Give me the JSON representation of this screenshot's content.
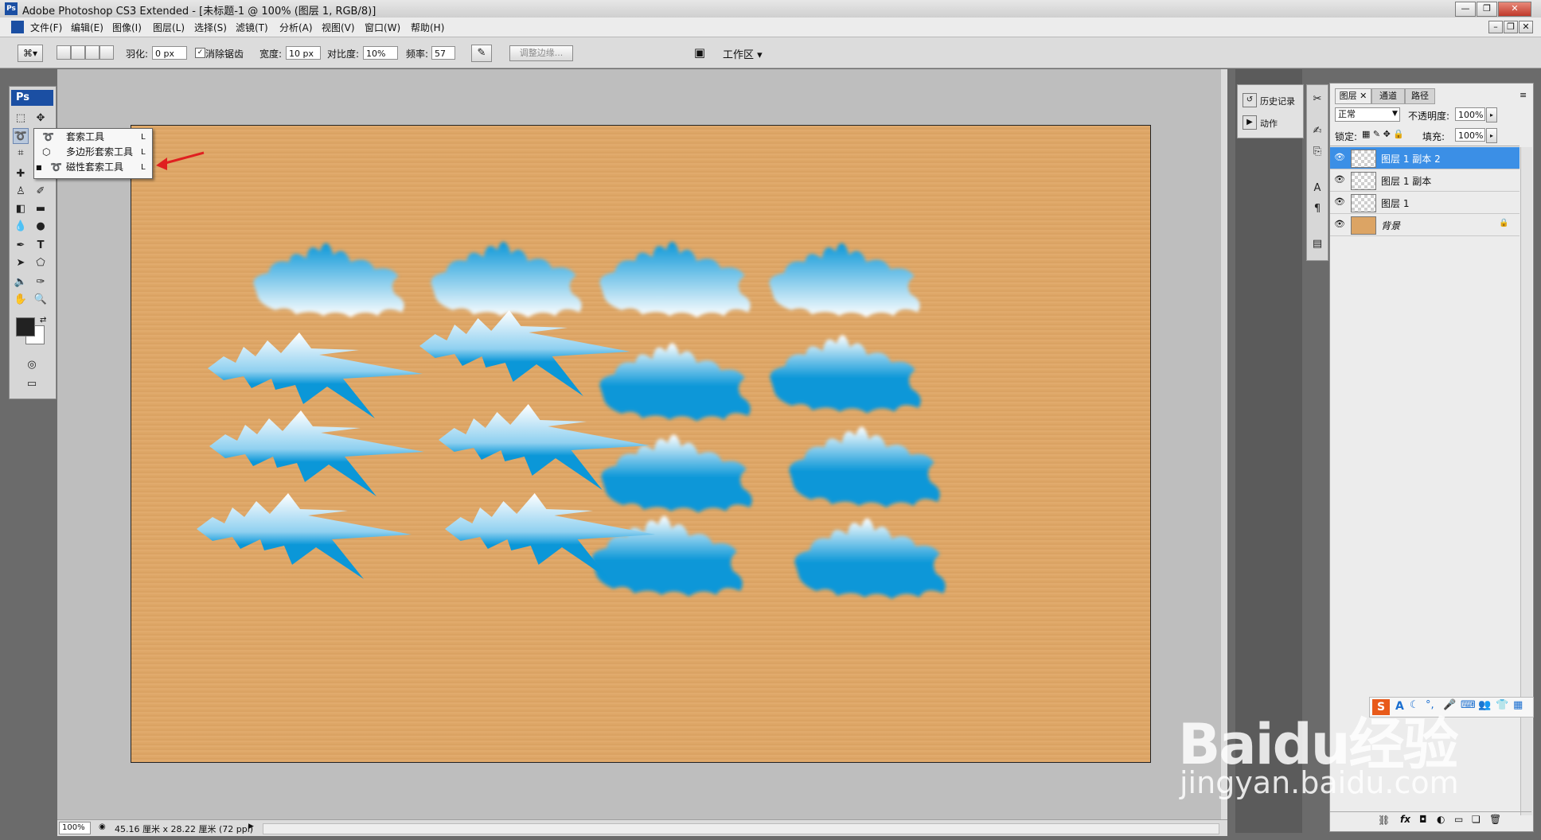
{
  "window": {
    "app_icon": "Ps",
    "title": "Adobe Photoshop CS3 Extended - [未标题-1 @ 100% (图层 1, RGB/8)]",
    "controls": [
      "minimize",
      "restore",
      "close"
    ]
  },
  "menu": {
    "items": [
      "文件(F)",
      "编辑(E)",
      "图像(I)",
      "图层(L)",
      "选择(S)",
      "滤镜(T)",
      "分析(A)",
      "视图(V)",
      "窗口(W)",
      "帮助(H)"
    ]
  },
  "options": {
    "feather_label": "羽化:",
    "feather_value": "0 px",
    "antialias_label": "消除锯齿",
    "width_label": "宽度:",
    "width_value": "10 px",
    "contrast_label": "对比度:",
    "contrast_value": "10%",
    "frequency_label": "频率:",
    "frequency_value": "57",
    "refine_edge": "调整边缘...",
    "workspace": "工作区 ▾"
  },
  "toolbox": {
    "logo": "Ps"
  },
  "flyout": {
    "items": [
      {
        "label": "套索工具",
        "key": "L",
        "selected": false
      },
      {
        "label": "多边形套索工具",
        "key": "L",
        "selected": false
      },
      {
        "label": "磁性套索工具",
        "key": "L",
        "selected": true
      }
    ]
  },
  "history_panel": {
    "items": [
      "历史记录",
      "动作"
    ]
  },
  "layers_panel": {
    "tabs": [
      "图层",
      "通道",
      "路径"
    ],
    "blend_mode": "正常",
    "opacity_label": "不透明度:",
    "opacity_value": "100%",
    "lock_label": "锁定:",
    "fill_label": "填充:",
    "fill_value": "100%",
    "layers": [
      {
        "name": "图层 1 副本 2",
        "selected": true,
        "locked": false
      },
      {
        "name": "图层 1 副本",
        "selected": false,
        "locked": false
      },
      {
        "name": "图层 1",
        "selected": false,
        "locked": false
      },
      {
        "name": "背景",
        "selected": false,
        "locked": true
      }
    ]
  },
  "status": {
    "zoom": "100%",
    "doc_info": "45.16 厘米 x 28.22 厘米 (72 ppi)"
  },
  "ime_toolbar": {
    "logo": "S",
    "mode": "A"
  },
  "watermark": {
    "brand": "Baidu经验",
    "url": "jingyan.baidu.com"
  },
  "colors": {
    "selected_layer": "#3b8fe6",
    "shape_blue": "#0b97d8",
    "canvas_wood": "#dca464",
    "arrow_red": "#e02020"
  }
}
